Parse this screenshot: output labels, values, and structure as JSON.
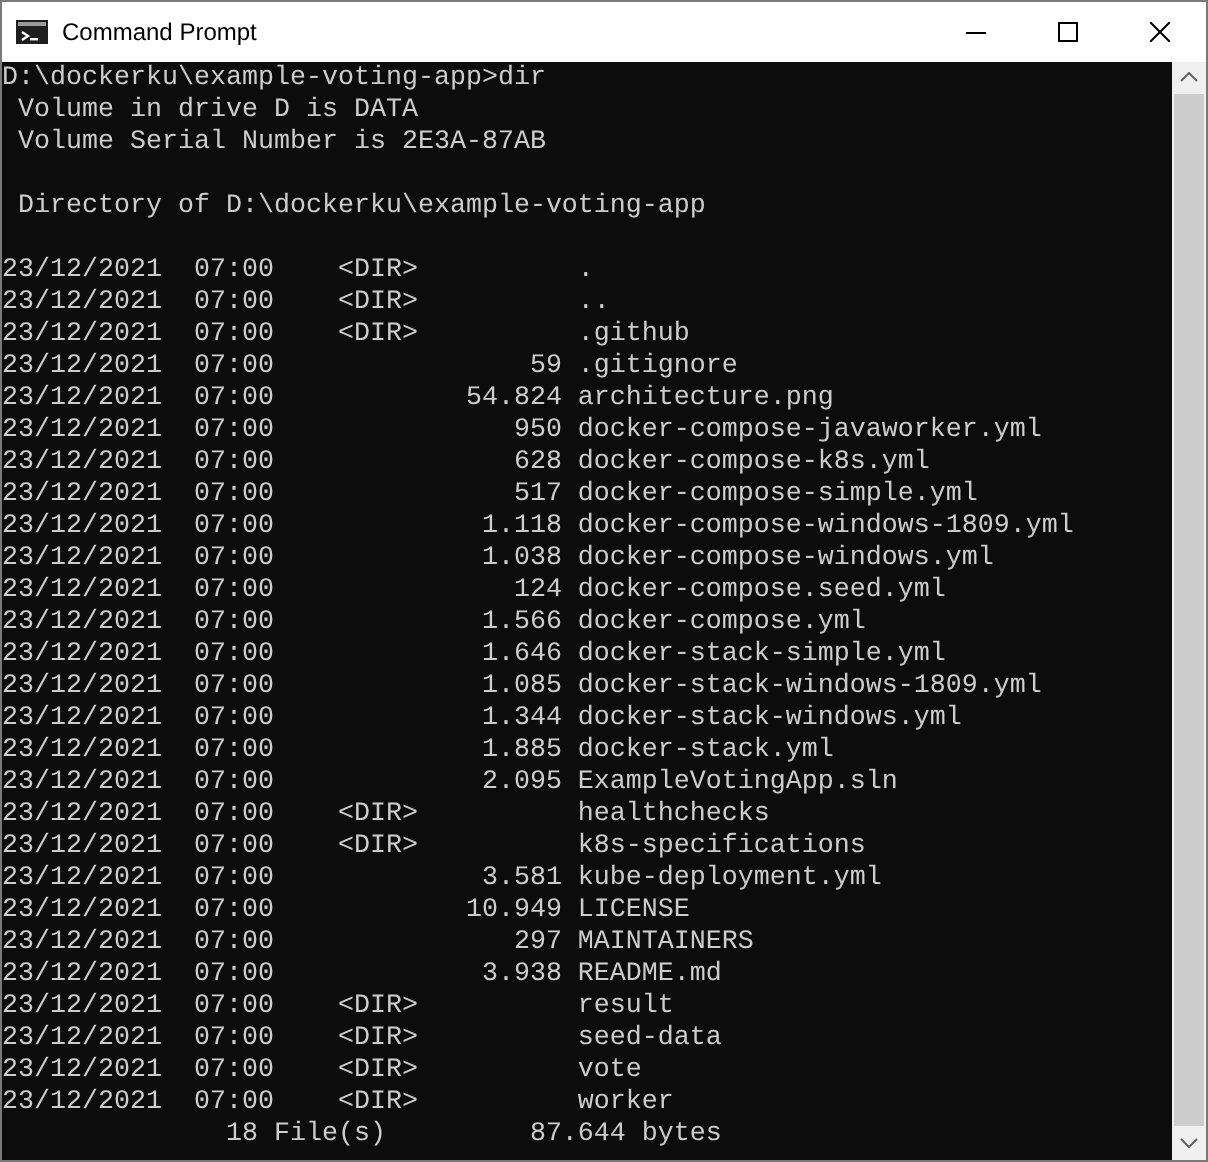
{
  "window": {
    "title": "Command Prompt"
  },
  "terminal": {
    "blocks": [
      [
        "D:\\dockerku\\example-voting-app>dir",
        " Volume in drive D is DATA",
        " Volume Serial Number is 2E3A-87AB"
      ],
      [
        " Directory of D:\\dockerku\\example-voting-app"
      ],
      [
        "23/12/2021  07:00    <DIR>          .",
        "23/12/2021  07:00    <DIR>          ..",
        "23/12/2021  07:00    <DIR>          .github",
        "23/12/2021  07:00                59 .gitignore",
        "23/12/2021  07:00            54.824 architecture.png",
        "23/12/2021  07:00               950 docker-compose-javaworker.yml",
        "23/12/2021  07:00               628 docker-compose-k8s.yml",
        "23/12/2021  07:00               517 docker-compose-simple.yml",
        "23/12/2021  07:00             1.118 docker-compose-windows-1809.yml",
        "23/12/2021  07:00             1.038 docker-compose-windows.yml",
        "23/12/2021  07:00               124 docker-compose.seed.yml",
        "23/12/2021  07:00             1.566 docker-compose.yml",
        "23/12/2021  07:00             1.646 docker-stack-simple.yml",
        "23/12/2021  07:00             1.085 docker-stack-windows-1809.yml",
        "23/12/2021  07:00             1.344 docker-stack-windows.yml",
        "23/12/2021  07:00             1.885 docker-stack.yml",
        "23/12/2021  07:00             2.095 ExampleVotingApp.sln",
        "23/12/2021  07:00    <DIR>          healthchecks",
        "23/12/2021  07:00    <DIR>          k8s-specifications",
        "23/12/2021  07:00             3.581 kube-deployment.yml",
        "23/12/2021  07:00            10.949 LICENSE",
        "23/12/2021  07:00               297 MAINTAINERS",
        "23/12/2021  07:00             3.938 README.md",
        "23/12/2021  07:00    <DIR>          result",
        "23/12/2021  07:00    <DIR>          seed-data",
        "23/12/2021  07:00    <DIR>          vote",
        "23/12/2021  07:00    <DIR>          worker",
        "              18 File(s)         87.644 bytes"
      ]
    ]
  }
}
